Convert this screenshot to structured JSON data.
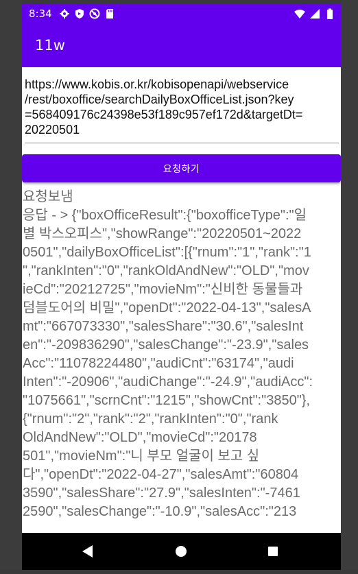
{
  "status_bar": {
    "time": "8:34",
    "icons_left": [
      "gear-icon",
      "shield-icon",
      "do-not-disturb-icon",
      "sd-card-icon"
    ],
    "icons_right": [
      "wifi-icon",
      "signal-icon",
      "battery-icon"
    ]
  },
  "app_bar": {
    "title": "11w"
  },
  "url_input": {
    "value_lines": [
      "https://www.kobis.or.kr/kobisopenapi/webservice",
      "/rest/boxoffice/searchDailyBoxOfficeList.json?key",
      "=568409176c24398e53f189c957ef172d&targetDt=",
      "20220501"
    ]
  },
  "request_button": {
    "label": "요청하기"
  },
  "output": {
    "lines": [
      "요청보냄",
      "응답 - > {\"boxOfficeResult\":{\"boxofficeType\":\"일",
      "별 박스오피스\",\"showRange\":\"20220501~2022",
      "0501\",\"dailyBoxOfficeList\":[{\"rnum\":\"1\",\"rank\":\"1",
      "\",\"rankInten\":\"0\",\"rankOldAndNew\":\"OLD\",\"mov",
      "ieCd\":\"20212725\",\"movieNm\":\"신비한 동물들과",
      "덤블도어의 비밀\",\"openDt\":\"2022-04-13\",\"salesA",
      "mt\":\"667073330\",\"salesShare\":\"30.6\",\"salesInt",
      "en\":\"-209836290\",\"salesChange\":\"-23.9\",\"sales",
      "Acc\":\"11078224480\",\"audiCnt\":\"63174\",\"audi",
      "Inten\":\"-20906\",\"audiChange\":\"-24.9\",\"audiAcc\":",
      "\"1075661\",\"scrnCnt\":\"1215\",\"showCnt\":\"3850\"},",
      "{\"rnum\":\"2\",\"rank\":\"2\",\"rankInten\":\"0\",\"rank",
      "OldAndNew\":\"OLD\",\"movieCd\":\"20178",
      "501\",\"movieNm\":\"니 부모 얼굴이 보고 싶",
      "다\",\"openDt\":\"2022-04-27\",\"salesAmt\":\"60804",
      "3590\",\"salesShare\":\"27.9\",\"salesInten\":\"-7461",
      "2590\",\"salesChange\":\"-10.9\",\"salesAcc\":\"213"
    ]
  },
  "nav_bar": {
    "icons": [
      "back-icon",
      "home-icon",
      "recents-icon"
    ]
  },
  "colors": {
    "primary": "#6200ee",
    "output_text": "#6b6b6b"
  }
}
